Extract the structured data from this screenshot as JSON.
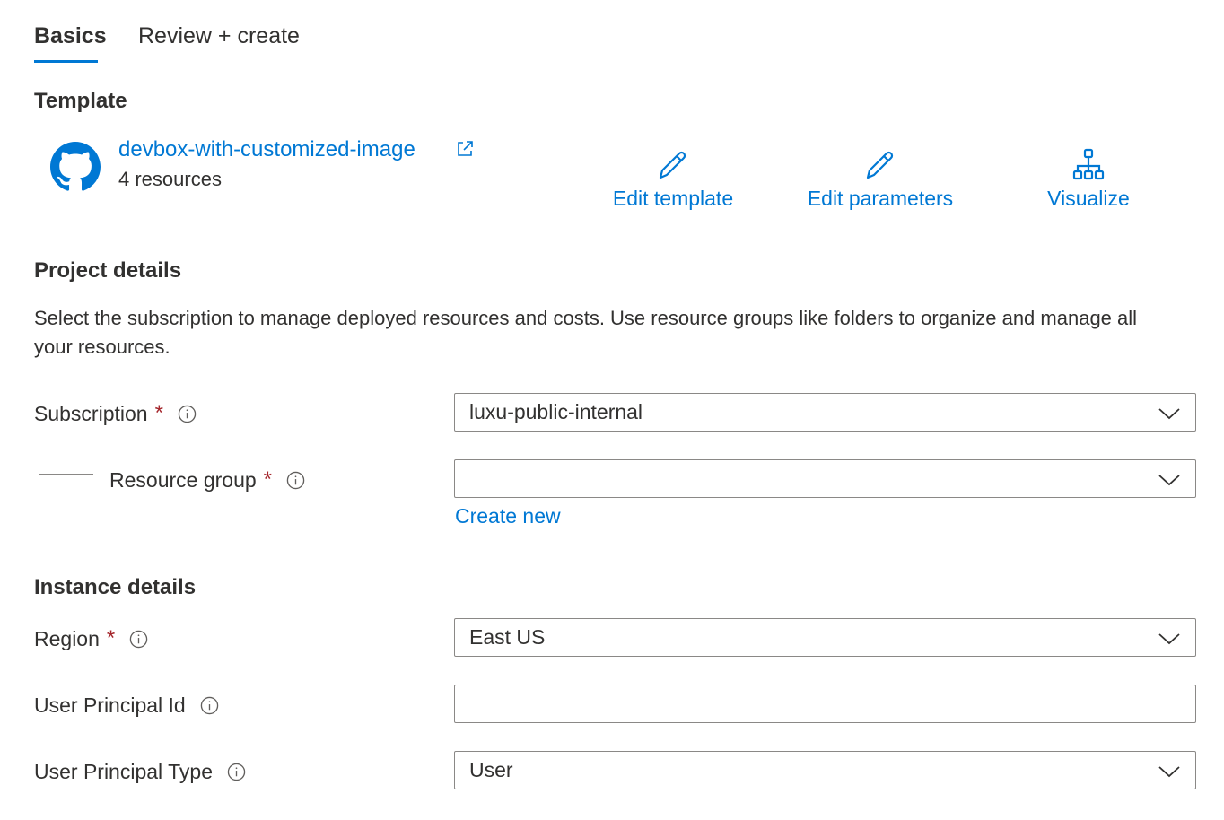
{
  "tabs": [
    {
      "label": "Basics",
      "active": true
    },
    {
      "label": "Review + create",
      "active": false
    }
  ],
  "template": {
    "section_title": "Template",
    "name": "devbox-with-customized-image",
    "resources": "4 resources",
    "actions": [
      {
        "label": "Edit template",
        "icon": "pencil-icon"
      },
      {
        "label": "Edit parameters",
        "icon": "pencil-icon"
      },
      {
        "label": "Visualize",
        "icon": "hierarchy-icon"
      }
    ]
  },
  "project": {
    "section_title": "Project details",
    "description": "Select the subscription to manage deployed resources and costs. Use resource groups like folders to organize and manage all your resources.",
    "subscription": {
      "label": "Subscription",
      "required": "*",
      "value": "luxu-public-internal"
    },
    "resource_group": {
      "label": "Resource group",
      "required": "*",
      "value": "",
      "create_new": "Create new"
    }
  },
  "instance": {
    "section_title": "Instance details",
    "region": {
      "label": "Region",
      "required": "*",
      "value": "East US"
    },
    "user_principal_id": {
      "label": "User Principal Id",
      "value": ""
    },
    "user_principal_type": {
      "label": "User Principal Type",
      "value": "User"
    }
  },
  "colors": {
    "accent": "#0078d4",
    "required": "#a4262c",
    "text": "#323130",
    "border": "#8a8886"
  }
}
